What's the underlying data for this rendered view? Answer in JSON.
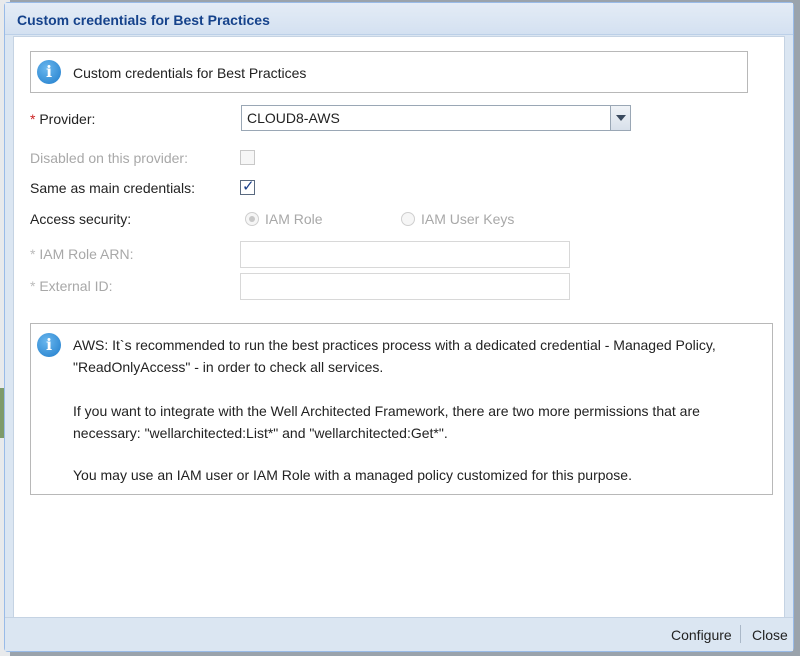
{
  "window": {
    "title": "Custom credentials for Best Practices"
  },
  "header_info": {
    "text": "Custom credentials for Best Practices",
    "icon": "info-icon"
  },
  "form": {
    "provider": {
      "required_mark": "*",
      "label": "Provider:",
      "value": "CLOUD8-AWS"
    },
    "disabled_on_provider": {
      "label": "Disabled on this provider:",
      "checked": false,
      "enabled": false
    },
    "same_as_main": {
      "label": "Same as main credentials:",
      "checked": true
    },
    "access_security": {
      "label": "Access security:",
      "options": [
        {
          "label": "IAM Role",
          "selected": true
        },
        {
          "label": "IAM User Keys",
          "selected": false
        }
      ]
    },
    "iam_role_arn": {
      "required_mark": "*",
      "label": "IAM Role ARN:",
      "value": ""
    },
    "external_id": {
      "required_mark": "*",
      "label": "External ID:",
      "value": ""
    }
  },
  "aws_info": {
    "icon": "info-icon",
    "lines": [
      "AWS: It`s recommended to run the best practices process with a dedicated credential - Managed Policy,",
      "\"ReadOnlyAccess\" - in order to check all services.",
      "If you want to integrate with the Well Architected Framework, there are two more permissions that are",
      "necessary: \"wellarchitected:List*\" and \"wellarchitected:Get*\".",
      "You may use an IAM user or IAM Role with a managed policy customized for this purpose."
    ]
  },
  "footer": {
    "configure_label": "Configure",
    "close_label": "Close"
  },
  "colors": {
    "title_text": "#15428b",
    "window_frame": "#dbe6f2",
    "required_mark": "#cc2222",
    "info_icon": "#1f7ccb"
  }
}
